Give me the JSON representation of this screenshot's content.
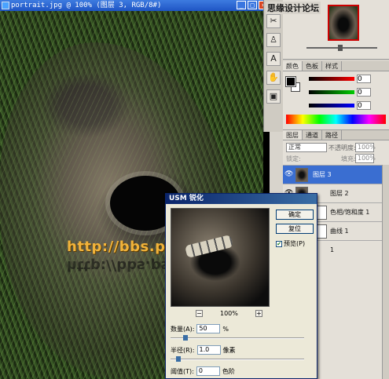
{
  "document": {
    "title": "portrait.jpg @ 100% (图层 3, RGB/8#)"
  },
  "watermark": {
    "text": "http://bbs.psfeng.cn/"
  },
  "site_logo": {
    "text": "思缘设计论坛"
  },
  "color_panel": {
    "tabs": [
      "颜色",
      "色板",
      "样式"
    ],
    "values": [
      "0",
      "0",
      "0"
    ]
  },
  "layers_panel": {
    "tabs": [
      "图层",
      "通道",
      "路径"
    ],
    "blend_mode": "正常",
    "opacity_label": "不透明度:",
    "opacity_value": "100%",
    "lock_label": "锁定:",
    "fill_label": "填充:",
    "fill_value": "100%",
    "layers": [
      {
        "name": "图层 3",
        "selected": true
      },
      {
        "name": "图层 2",
        "selected": false
      },
      {
        "name": "色相/饱和度 1",
        "selected": false
      },
      {
        "name": "曲线 1",
        "selected": false
      },
      {
        "name": "1",
        "selected": false
      }
    ]
  },
  "usm_dialog": {
    "title": "USM 锐化",
    "ok_label": "确定",
    "reset_label": "复位",
    "preview_label": "预览(P)",
    "preview_checked": true,
    "zoom_minus": "−",
    "zoom_plus": "+",
    "zoom": "100%",
    "amount_label": "数量(A):",
    "amount_value": "50",
    "amount_unit": "%",
    "amount_fraction": 0.1,
    "radius_label": "半径(R):",
    "radius_value": "1.0",
    "radius_unit": "像素",
    "radius_fraction": 0.04,
    "threshold_label": "阈值(T):",
    "threshold_value": "0",
    "threshold_unit": "色阶",
    "threshold_fraction": 0.0
  }
}
